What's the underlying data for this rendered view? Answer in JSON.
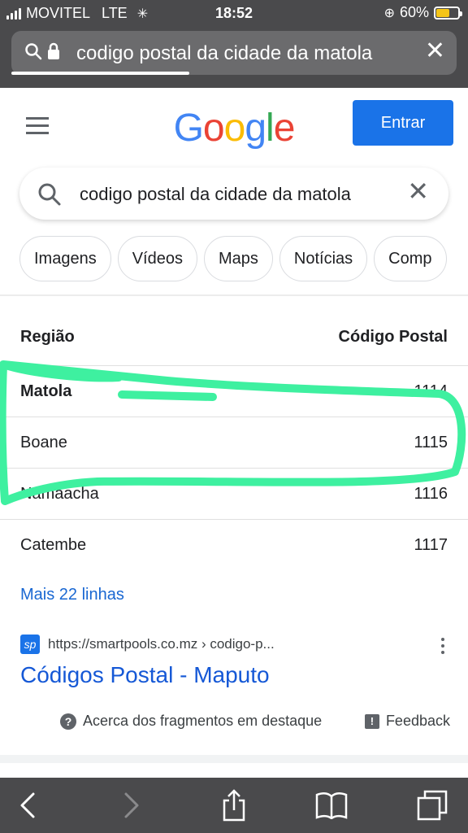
{
  "status_bar": {
    "carrier": "MOVITEL",
    "network": "LTE",
    "time": "18:52",
    "battery": "60%",
    "battery_level": 0.6
  },
  "url_bar": {
    "query": "codigo postal da cidade da matola",
    "load_progress": 0.4
  },
  "header": {
    "logo": [
      "G",
      "o",
      "o",
      "g",
      "l",
      "e"
    ],
    "signin_label": "Entrar"
  },
  "search": {
    "query": "codigo postal da cidade da matola"
  },
  "chips": [
    "Imagens",
    "Vídeos",
    "Maps",
    "Notícias",
    "Comp"
  ],
  "table": {
    "headers": [
      "Região",
      "Código Postal"
    ],
    "rows": [
      {
        "region": "Matola",
        "code": "1114"
      },
      {
        "region": "Boane",
        "code": "1115"
      },
      {
        "region": "Namaacha",
        "code": "1116"
      },
      {
        "region": "Catembe",
        "code": "1117"
      }
    ],
    "more_label": "Mais 22 linhas"
  },
  "result": {
    "url": "https://smartpools.co.mz › codigo-p...",
    "title": "Códigos Postal - Maputo"
  },
  "snippet_footer": {
    "about": "Acerca dos fragmentos em destaque",
    "feedback": "Feedback"
  },
  "colors": {
    "accent": "#1a73e8",
    "link": "#1558d6",
    "highlight": "#3ef0a0",
    "chrome": "#4a4a4c"
  }
}
